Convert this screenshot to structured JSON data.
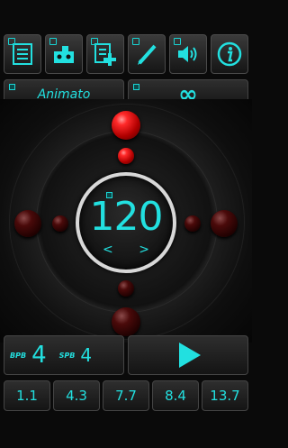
{
  "toolbar": {
    "buttons": [
      {
        "icon": "list-icon"
      },
      {
        "icon": "radio-icon"
      },
      {
        "icon": "add-document-icon"
      },
      {
        "icon": "pen-icon"
      },
      {
        "icon": "speaker-icon"
      },
      {
        "icon": "info-icon"
      }
    ]
  },
  "tempo": {
    "marking": "Animato",
    "repeat": "∞"
  },
  "dial": {
    "bpm": "120",
    "left_arrow": "<",
    "right_arrow": ">"
  },
  "meter": {
    "bpb_label": "BPB",
    "bpb_value": "4",
    "spb_label": "SPB",
    "spb_value": "4"
  },
  "presets": [
    "1.1",
    "4.3",
    "7.7",
    "8.4",
    "13.7"
  ],
  "colors": {
    "accent": "#22e0e0",
    "beat": "#e01010"
  }
}
